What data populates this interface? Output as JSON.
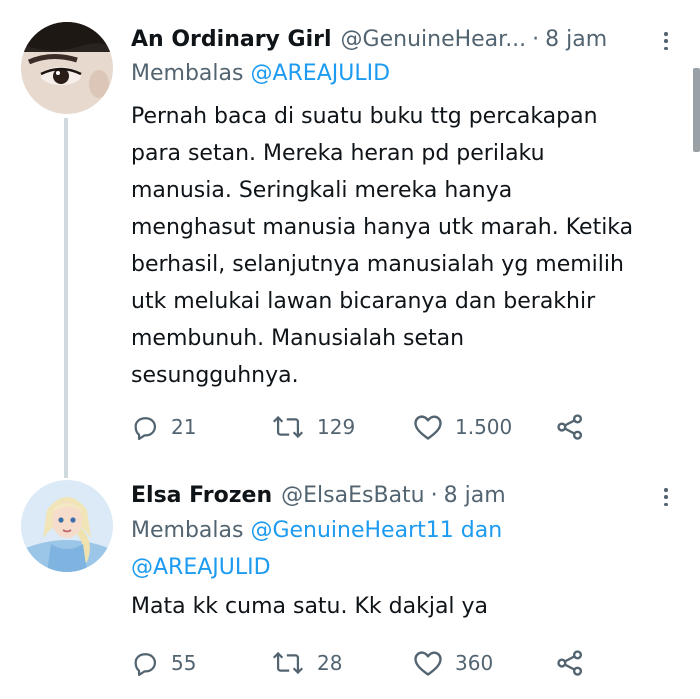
{
  "tweets": [
    {
      "name": "An Ordinary Girl",
      "handle": "@GenuineHear...",
      "separator": "·",
      "time": "8 jam",
      "reply_prefix": "Membalas",
      "reply_mention": "@AREAJULID",
      "reply_joiner": "",
      "reply_mention_2": "",
      "text_lines": [
        "Pernah baca di suatu buku ttg percakapan",
        "para setan. Mereka heran pd perilaku",
        "manusia. Seringkali mereka hanya",
        "menghasut manusia hanya utk marah. Ketika",
        "berhasil, selanjutnya manusialah yg memilih",
        "utk melukai lawan bicaranya dan berakhir",
        "membunuh. Manusialah setan",
        "sesungguhnya."
      ],
      "replies": "21",
      "retweets": "129",
      "likes": "1.500",
      "avatar_icon": "avatar-eye-photo"
    },
    {
      "name": "Elsa Frozen",
      "handle": "@ElsaEsBatu",
      "separator": "·",
      "time": "8 jam",
      "reply_prefix": "Membalas",
      "reply_mention": "@GenuineHeart11",
      "reply_joiner": "dan",
      "reply_mention_2": "@AREAJULID",
      "text_lines": [
        "Mata kk cuma satu. Kk dakjal ya"
      ],
      "replies": "55",
      "retweets": "28",
      "likes": "360",
      "avatar_icon": "avatar-elsa-cartoon"
    }
  ],
  "colors": {
    "link": "#1d9bf0",
    "secondary": "#536471",
    "primary": "#0f1419",
    "thread_line": "#cfd9de"
  }
}
